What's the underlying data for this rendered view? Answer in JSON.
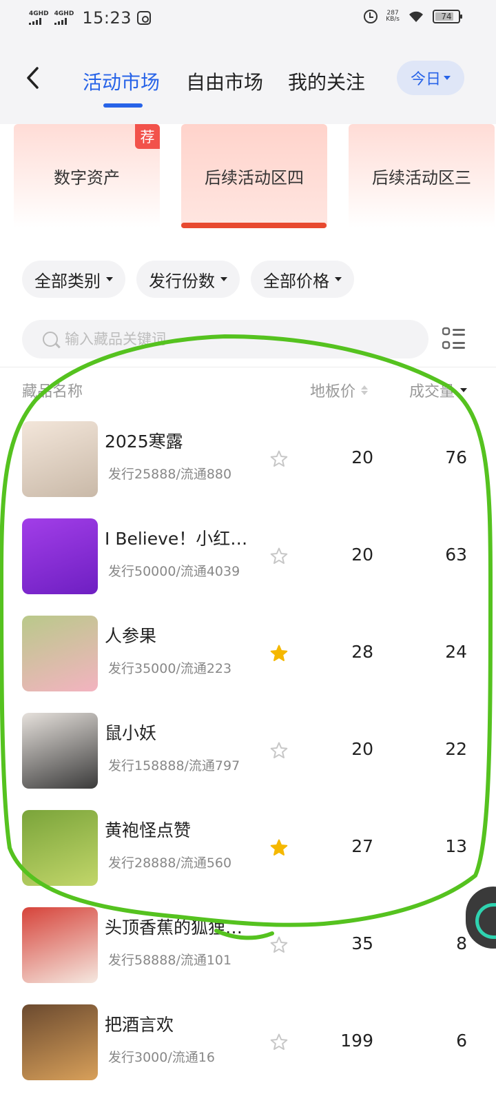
{
  "status": {
    "sim1": "4GHD",
    "sim2": "4GHD",
    "time": "15:23",
    "net_speed": "287",
    "net_unit": "KB/s",
    "battery": "74"
  },
  "nav": {
    "tabs": [
      {
        "label": "活动市场",
        "active": true
      },
      {
        "label": "自由市场",
        "active": false
      },
      {
        "label": "我的关注",
        "active": false
      }
    ],
    "period": "今日"
  },
  "zones": [
    {
      "label": "数字资产",
      "badge": "荐"
    },
    {
      "label": "后续活动区四",
      "active": true
    },
    {
      "label": "后续活动区三"
    }
  ],
  "filters": [
    "全部类别",
    "发行份数",
    "全部价格"
  ],
  "search": {
    "placeholder": "输入藏品关键词"
  },
  "columns": {
    "name": "藏品名称",
    "floor": "地板价",
    "volume": "成交量"
  },
  "items": [
    {
      "title": "2025寒露",
      "sub": "发行25888/流通880",
      "floor": "20",
      "volume": "76",
      "starred": false,
      "thumb_colors": [
        "#f3e6da",
        "#c9b9a8"
      ]
    },
    {
      "title": "I Believe！小红…",
      "sub": "发行50000/流通4039",
      "floor": "20",
      "volume": "63",
      "starred": false,
      "thumb_colors": [
        "#a23ee8",
        "#6e1fc2"
      ]
    },
    {
      "title": "人参果",
      "sub": "发行35000/流通223",
      "floor": "28",
      "volume": "24",
      "starred": true,
      "thumb_colors": [
        "#b9c98a",
        "#f3b3c0"
      ]
    },
    {
      "title": "鼠小妖",
      "sub": "发行158888/流通797",
      "floor": "20",
      "volume": "22",
      "starred": false,
      "thumb_colors": [
        "#e6e1dc",
        "#3a3a3a"
      ]
    },
    {
      "title": "黄袍怪点赞",
      "sub": "发行28888/流通560",
      "floor": "27",
      "volume": "13",
      "starred": true,
      "thumb_colors": [
        "#7aa43a",
        "#c2d66a"
      ]
    },
    {
      "title": "头顶香蕉的狐狸…",
      "sub": "发行58888/流通101",
      "floor": "35",
      "volume": "8",
      "starred": false,
      "thumb_colors": [
        "#d6433a",
        "#f5e8e0"
      ]
    },
    {
      "title": "把酒言欢",
      "sub": "发行3000/流通16",
      "floor": "199",
      "volume": "6",
      "starred": false,
      "thumb_colors": [
        "#6b4a2f",
        "#d8a05a"
      ]
    }
  ],
  "colors": {
    "accent": "#2763e8",
    "zone_underline": "#e8492f",
    "badge": "#f2524b",
    "star_on": "#f5b800",
    "annotation_stroke": "#55c21f"
  }
}
